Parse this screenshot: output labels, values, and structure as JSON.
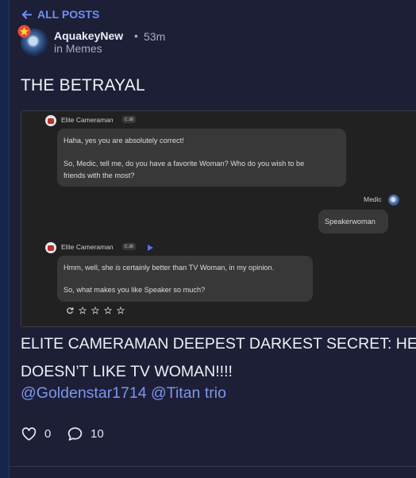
{
  "nav": {
    "back_label": "ALL POSTS",
    "back_icon": "arrow-left-icon"
  },
  "post": {
    "author": "AquakeyNew",
    "separator": "•",
    "time": "53m",
    "community": "in Memes",
    "title": "THE BETRAYAL",
    "body_line1": "ELITE CAMERAMAN DEEPEST DARKEST SECRET: HE",
    "body_line2": "DOESN’T LIKE TV WOMAN!!!!",
    "mentions": "@Goldenstar1714 @Titan trio",
    "likes": "0",
    "comments": "10"
  },
  "chat": {
    "bot_name": "Elite Cameraman",
    "bot_tag": "c.ai",
    "msg1_p1": "Haha, yes you are absolutely correct!",
    "msg1_p2": "So, Medic, tell me, do you have a favorite Woman? Who do you wish to be",
    "msg1_p3": "friends with the most?",
    "user_name": "Medic",
    "user_msg": "Speakerwoman",
    "msg2_pre": "Hmm, well, she ",
    "msg2_em": "is",
    "msg2_post": " certainly better than TV Woman, in my opinion.",
    "msg2_p2": "So, what makes you like Speaker so much?"
  },
  "colors": {
    "accent": "#6f8ff7",
    "background": "#1d1f36",
    "chat_bg": "#212121",
    "bubble": "#383838"
  }
}
